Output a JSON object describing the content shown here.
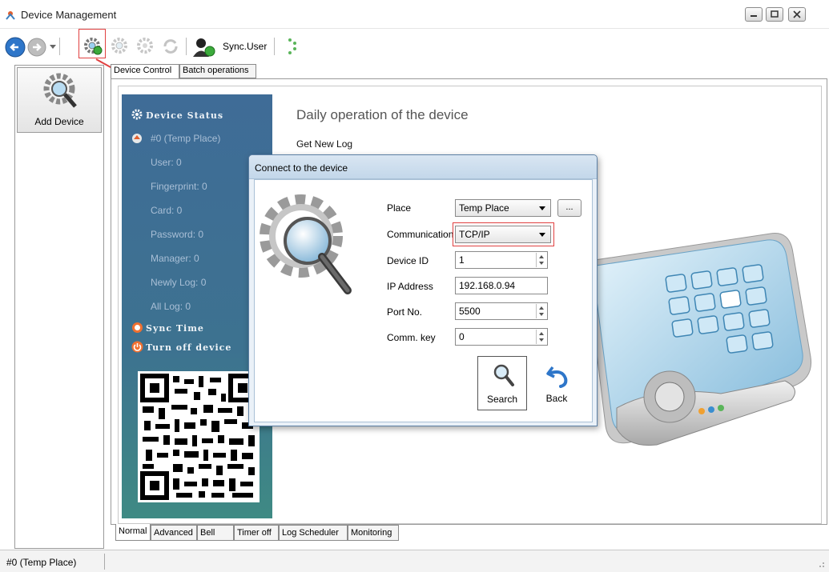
{
  "window": {
    "title": "Device Management"
  },
  "toolbar": {
    "sync_user_label": "Sync.User"
  },
  "left_panel": {
    "add_device_label": "Add Device"
  },
  "tabs_top": [
    "Device Control",
    "Batch operations"
  ],
  "status_panel": {
    "header": "Device Status",
    "device": "#0 (Temp Place)",
    "stats": [
      "User: 0",
      "Fingerprint: 0",
      "Card: 0",
      "Password: 0",
      "Manager: 0",
      "Newly Log: 0",
      "All Log: 0"
    ],
    "sync_time": "Sync Time",
    "turn_off": "Turn off device"
  },
  "main": {
    "daily_title": "Daily operation of the device",
    "get_new_log": "Get New Log"
  },
  "dialog": {
    "title": "Connect to the device",
    "place_label": "Place",
    "place_value": "Temp Place",
    "ellipsis": "...",
    "communication_label": "Communication",
    "communication_value": "TCP/IP",
    "device_id_label": "Device ID",
    "device_id_value": "1",
    "ip_label": "IP Address",
    "ip_value": "192.168.0.94",
    "port_label": "Port No.",
    "port_value": "5500",
    "comm_key_label": "Comm. key",
    "comm_key_value": "0",
    "search_label": "Search",
    "back_label": "Back"
  },
  "tabs_bottom": [
    "Normal",
    "Advanced",
    "Bell",
    "Timer off",
    "Log Scheduler",
    "Monitoring"
  ],
  "statusbar": {
    "text": "#0 (Temp Place)"
  },
  "colors": {
    "highlight": "#e04040",
    "status_panel": "#3f6c97",
    "dialog_bg": "#eaf1f8"
  }
}
